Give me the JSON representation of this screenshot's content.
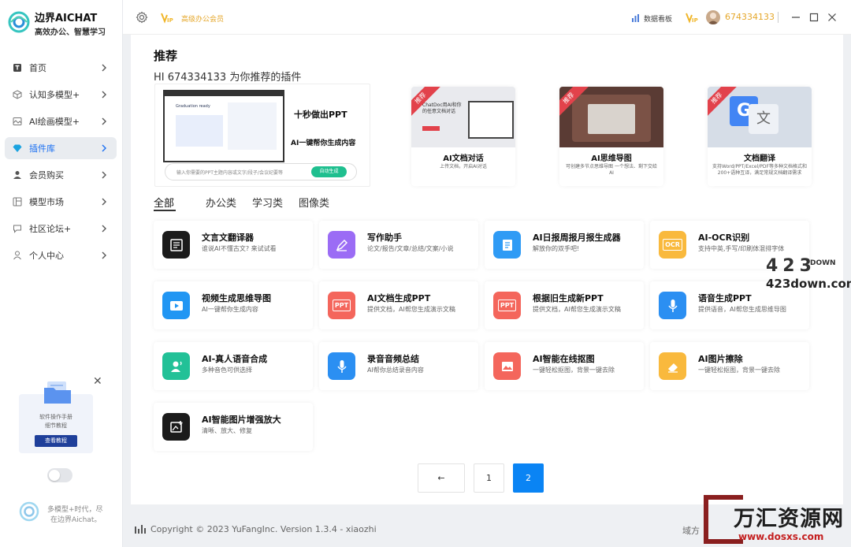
{
  "brand": {
    "name": "边界AICHAT",
    "tagline": "高效办公、智慧学习"
  },
  "sidebar": {
    "items": [
      {
        "label": "首页",
        "icon": "text-t-icon"
      },
      {
        "label": "认知多模型+",
        "icon": "cube-icon"
      },
      {
        "label": "AI绘画模型+",
        "icon": "image-icon"
      },
      {
        "label": "插件库",
        "icon": "gem-icon",
        "active": true
      },
      {
        "label": "会员购买",
        "icon": "user-icon"
      },
      {
        "label": "模型市场",
        "icon": "layout-icon"
      },
      {
        "label": "社区论坛+",
        "icon": "chat-icon"
      },
      {
        "label": "个人中心",
        "icon": "person-icon"
      }
    ],
    "promo": {
      "line1": "软件操作手册",
      "line2": "细节教程",
      "button": "查看教程"
    },
    "footer": {
      "line1": "多模型+时代，尽",
      "line2": "在边界Aichat。"
    }
  },
  "topbar": {
    "vip_text": "高级办公会员",
    "dashboard": "数据看板",
    "username": "674334133"
  },
  "main": {
    "title": "推荐",
    "subtitle": "HI 674334133 为你推荐的插件",
    "hero": {
      "mock_title": "Graduation ready",
      "headline": "十秒做出PPT",
      "subline": "AI一键帮你生成内容",
      "input_placeholder": "输入你需要的PPT主题内容或文字/段子/会议纪要等",
      "button": "自动生成"
    },
    "recommend": [
      {
        "badge": "推荐",
        "name": "AI文档对话",
        "desc": "上传文档，开启AI对话",
        "img_text": "ChatDoc用AI和你的任意文档对话"
      },
      {
        "badge": "推荐",
        "name": "AI思维导图",
        "desc": "可创建多节点思维导图 一个想法、剩下交给AI"
      },
      {
        "badge": "推荐",
        "name": "文档翻译",
        "desc": "支持Word/PPT/Excel/PDF等多种文档格式和200+语种互译，满足常规文档翻译需求"
      }
    ],
    "tabs": [
      "全部",
      "办公类",
      "学习类",
      "图像类"
    ],
    "tools": [
      {
        "name": "文言文翻译器",
        "desc": "谁说AI不懂古文? 来试试看",
        "color": "#1b1b1b",
        "icon": "book-icon"
      },
      {
        "name": "写作助手",
        "desc": "论文/报告/文章/总结/文案/小说",
        "color": "#9b6cf5",
        "icon": "pen-icon"
      },
      {
        "name": "AI日报周报月报生成器",
        "desc": "解放你的双手吧!",
        "color": "#2f9bf5",
        "icon": "report-icon"
      },
      {
        "name": "AI-OCR识别",
        "desc": "支持中英,手写/印刷体混排字体",
        "color": "#f9b93d",
        "icon": "ocr-icon",
        "icon_text": "OCR"
      },
      {
        "name": "视频生成思维导图",
        "desc": "AI一键帮你生成内容",
        "color": "#2196f3",
        "icon": "video-icon"
      },
      {
        "name": "AI文档生成PPT",
        "desc": "提供文档，AI帮您生成演示文稿",
        "color": "#f4665c",
        "icon": "ppt-icon",
        "icon_text": "PPT"
      },
      {
        "name": "根据旧生成新PPT",
        "desc": "提供文档，AI帮您生成演示文稿",
        "color": "#f4665c",
        "icon": "ppt-icon",
        "icon_text": "PPT"
      },
      {
        "name": "语音生成PPT",
        "desc": "提供语音，AI帮您生成思维导图",
        "color": "#2b8ff2",
        "icon": "mic-icon"
      },
      {
        "name": "AI-真人语音合成",
        "desc": "多种音色可供选择",
        "color": "#22c197",
        "icon": "voice-person-icon"
      },
      {
        "name": "录音音频总结",
        "desc": "AI帮你总结录音内容",
        "color": "#2b8ff2",
        "icon": "mic-icon"
      },
      {
        "name": "AI智能在线抠图",
        "desc": "一键轻松抠图，背景一键去除",
        "color": "#f4665c",
        "icon": "picture-icon"
      },
      {
        "name": "AI图片擦除",
        "desc": "一键轻松抠图，背景一键去除",
        "color": "#f9b93d",
        "icon": "eraser-icon"
      },
      {
        "name": "AI智能图片增强放大",
        "desc": "清晰、放大、修复",
        "color": "#1b1b1b",
        "icon": "enhance-icon"
      }
    ],
    "pagination": {
      "prev": "←",
      "pages": [
        "1",
        "2"
      ],
      "current": "2"
    }
  },
  "bottombar": {
    "copyright": "Copyright © 2023 YuFangInc. Version 1.3.4 - xiaozhi",
    "right": "域方"
  },
  "watermarks": {
    "w1_num": "423",
    "w1_down": "DOWN",
    "w1_url": "423down.com",
    "w2_title": "万汇资源网",
    "w2_url": "www.dosxs.com"
  }
}
